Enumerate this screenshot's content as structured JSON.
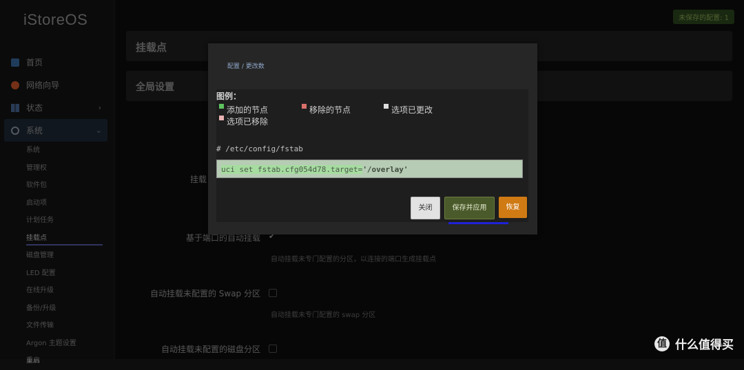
{
  "brand": "iStoreOS",
  "sidebar": {
    "items": [
      {
        "label": "首页",
        "icon": "home-icon"
      },
      {
        "label": "网络向导",
        "icon": "wizard-icon"
      },
      {
        "label": "状态",
        "icon": "status-icon"
      },
      {
        "label": "系统",
        "icon": "gear-icon"
      }
    ],
    "sub": [
      "系统",
      "管理权",
      "软件包",
      "启动项",
      "计划任务",
      "挂载点",
      "磁盘管理",
      "LED 配置",
      "在线升级",
      "备份/升级",
      "文件传输",
      "Argon 主题设置",
      "重启"
    ]
  },
  "unsaved_badge": "未保存的配置: 1",
  "page": {
    "title": "挂载点",
    "section": "全局设置",
    "fields": [
      {
        "label": "挂载",
        "help": ""
      },
      {
        "label": "基于端口的自动挂载",
        "help": "自动挂载未专门配置的分区，以连接的端口生成挂载点",
        "checked": true
      },
      {
        "label": "自动挂载未配置的 Swap 分区",
        "help": "自动挂载未专门配置的 swap 分区",
        "checked": false
      },
      {
        "label": "自动挂载未配置的磁盘分区",
        "checked": false
      }
    ]
  },
  "modal": {
    "breadcrumb": "配置 / 更改数",
    "legend_title": "图例：",
    "legend": {
      "added": "添加的节点",
      "removed": "移除的节点",
      "changed": "选项已更改",
      "option_removed": "选项已移除"
    },
    "path": "# /etc/config/fstab",
    "code_prefix": "uci set fstab.cfg054d78.target=",
    "code_value": "'/overlay'",
    "buttons": {
      "close": "关闭",
      "save": "保存并应用",
      "revert": "恢复"
    }
  },
  "watermark": {
    "icon_text": "值",
    "text": "什么值得买"
  },
  "colors": {
    "save_button": "#4a5a2a",
    "revert_button": "#d07a14",
    "added": "#5ec25e",
    "removed": "#d9706a"
  }
}
